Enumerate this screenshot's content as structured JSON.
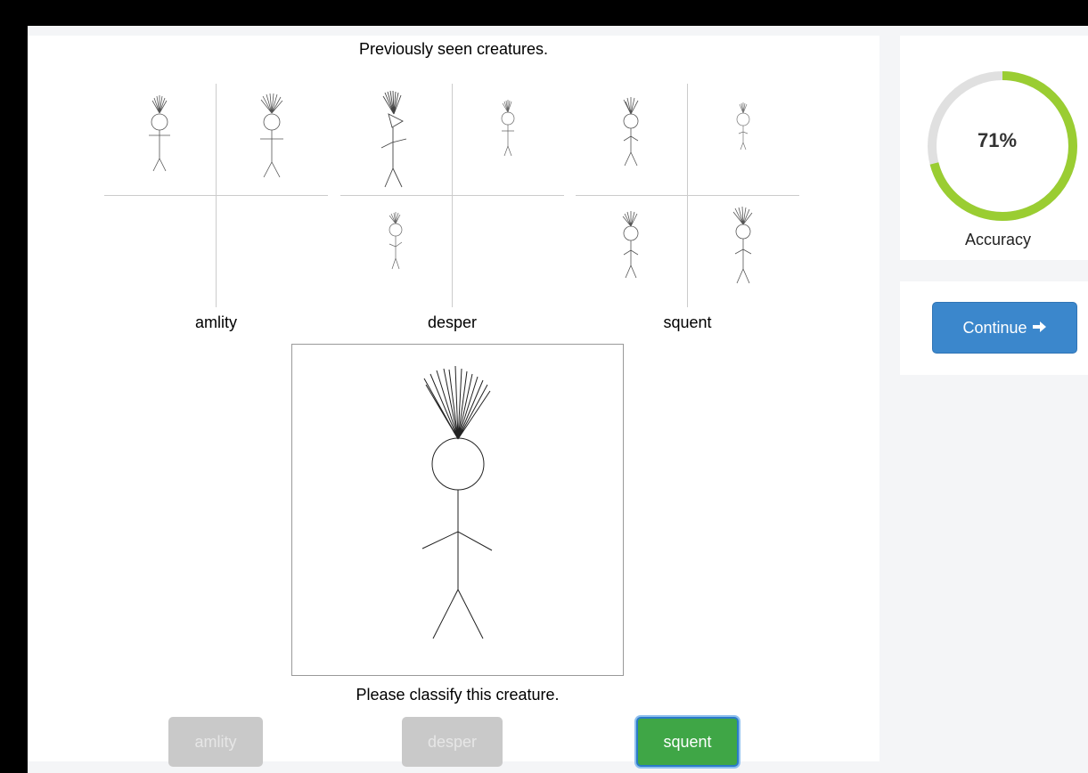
{
  "header": {
    "title": "Previously seen creatures."
  },
  "groups": [
    {
      "label": "amlity"
    },
    {
      "label": "desper"
    },
    {
      "label": "squent"
    }
  ],
  "prompt": "Please classify this creature.",
  "choices": [
    {
      "label": "amlity",
      "state": "disabled"
    },
    {
      "label": "desper",
      "state": "disabled"
    },
    {
      "label": "squent",
      "state": "selected"
    }
  ],
  "accuracy": {
    "value": 0.71,
    "percent_text": "71%",
    "label": "Accuracy",
    "color": "#9acd32",
    "track_color": "#e0e0e0"
  },
  "continue": {
    "label": "Continue",
    "icon": "arrow-right-icon",
    "color": "#3b87cc"
  }
}
